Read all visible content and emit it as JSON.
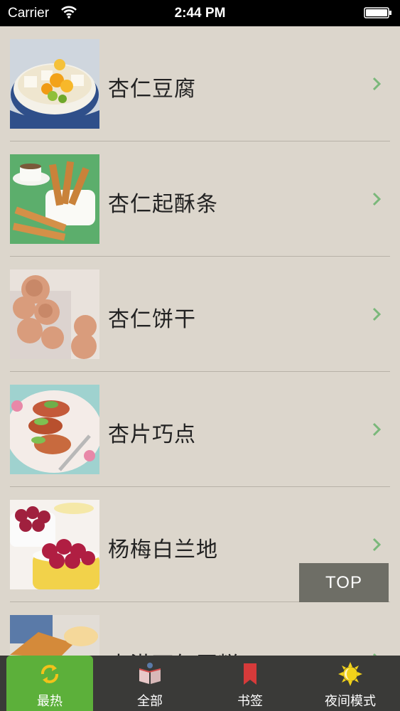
{
  "status_bar": {
    "carrier": "Carrier",
    "time": "2:44 PM"
  },
  "list": {
    "items": [
      {
        "title": "杏仁豆腐"
      },
      {
        "title": "杏仁起酥条"
      },
      {
        "title": "杏仁饼干"
      },
      {
        "title": "杏片巧点"
      },
      {
        "title": "杨梅白兰地"
      },
      {
        "title": "杏港下午蛋糕"
      }
    ]
  },
  "top_button": {
    "label": "TOP"
  },
  "tabs": [
    {
      "label": "最热",
      "icon": "refresh-icon",
      "active": true
    },
    {
      "label": "全部",
      "icon": "book-icon"
    },
    {
      "label": "书签",
      "icon": "bookmark-icon"
    },
    {
      "label": "夜间模式",
      "icon": "sun-icon"
    }
  ],
  "colors": {
    "accent": "#5cb03a",
    "chevron": "#7ab87a",
    "background": "#dcd6cc",
    "tab_bar": "#3a3a38"
  }
}
